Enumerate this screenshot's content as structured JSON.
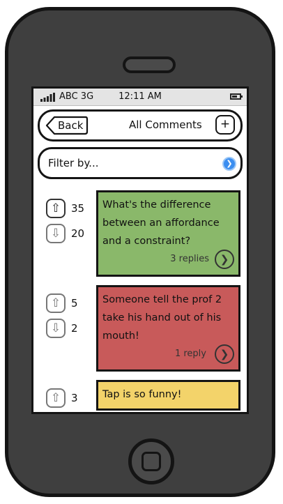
{
  "status_bar": {
    "carrier": "ABC 3G",
    "time": "12:11 AM",
    "icons": [
      "signal-bars-icon",
      "battery-icon"
    ]
  },
  "navbar": {
    "back_label": "Back",
    "title": "All Comments",
    "add_label": "+"
  },
  "filter": {
    "label": "Filter by...",
    "icon": "chevron-right-circle-icon"
  },
  "comments": [
    {
      "text": "What's the difference between an affordance and a constraint?",
      "upvotes": "35",
      "downvotes": "20",
      "replies": "3 replies",
      "color": "#8ab86a"
    },
    {
      "text": "Someone tell the prof 2 take his hand out of his mouth!",
      "upvotes": "5",
      "downvotes": "2",
      "replies": "1 reply",
      "color": "#c85a5a"
    },
    {
      "text": "Tap is so funny!",
      "upvotes": "3",
      "color": "#f3d36a"
    }
  ],
  "colors": {
    "phone_body": "#3f3f3f",
    "outline": "#141414",
    "status_bar": "#e4e4e4",
    "filter_accent": "#3b8ef0"
  }
}
